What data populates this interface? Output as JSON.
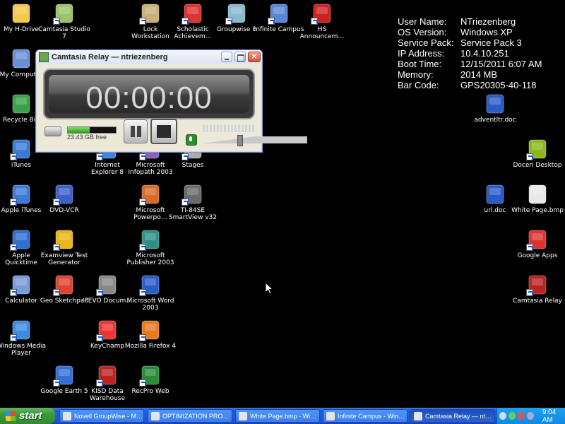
{
  "desktop": {
    "icons": [
      {
        "id": "my-h-drive",
        "label": "My H-Drive",
        "color": "#f2c94c",
        "shortcut": false
      },
      {
        "id": "camtasia-studio",
        "label": "Camtasia Studio 7",
        "color": "#9cc36e",
        "shortcut": true
      },
      {
        "id": "lock-workstation",
        "label": "Lock Workstation",
        "color": "#c9b07a",
        "shortcut": true
      },
      {
        "id": "scholastic",
        "label": "Scholastic Achievem…",
        "color": "#d33",
        "shortcut": true
      },
      {
        "id": "groupwise",
        "label": "Groupwise 8",
        "color": "#8ab8cf",
        "shortcut": true
      },
      {
        "id": "infinite-campus",
        "label": "Infinite Campus",
        "color": "#5a86d6",
        "shortcut": true
      },
      {
        "id": "hs-announcement",
        "label": "HS Announcem…",
        "color": "#c22",
        "shortcut": true
      },
      {
        "id": "my-computer",
        "label": "My Computer",
        "color": "#6a8fd6",
        "shortcut": false
      },
      {
        "id": "recycle-bin",
        "label": "Recycle Bin",
        "color": "#3aa04a",
        "shortcut": false
      },
      {
        "id": "itunes",
        "label": "iTunes",
        "color": "#3b7bd6",
        "shortcut": true
      },
      {
        "id": "internet-explorer",
        "label": "Internet Explorer 8",
        "color": "#3e87d8",
        "shortcut": true
      },
      {
        "id": "infopath",
        "label": "Microsoft Infopath 2003",
        "color": "#8860b8",
        "shortcut": true
      },
      {
        "id": "stages",
        "label": "Stages",
        "color": "#aaa",
        "shortcut": true
      },
      {
        "id": "apple-itunes",
        "label": "Apple iTunes",
        "color": "#3b7bd6",
        "shortcut": true
      },
      {
        "id": "dvd-vcr",
        "label": "DVD-VCR",
        "color": "#3d5fc6",
        "shortcut": true
      },
      {
        "id": "powerpoint",
        "label": "Microsoft Powerpo…",
        "color": "#d66b2a",
        "shortcut": true
      },
      {
        "id": "ti-84se",
        "label": "TI-84SE SmartView v32",
        "color": "#6b6b6b",
        "shortcut": true
      },
      {
        "id": "apple-quicktime",
        "label": "Apple Quicktime",
        "color": "#2e6fd0",
        "shortcut": true
      },
      {
        "id": "examview",
        "label": "Examview Test Generator",
        "color": "#e8b51a",
        "shortcut": true
      },
      {
        "id": "publisher",
        "label": "Microsoft Publisher 2003",
        "color": "#2f8f86",
        "shortcut": true
      },
      {
        "id": "calculator",
        "label": "Calculator",
        "color": "#7a9cd9",
        "shortcut": true
      },
      {
        "id": "geo-sketchpad",
        "label": "Geo Sketchpad",
        "color": "#d43",
        "shortcut": true
      },
      {
        "id": "ipevo",
        "label": "IPEVO Docum…",
        "color": "#888",
        "shortcut": true
      },
      {
        "id": "word",
        "label": "Microsoft Word 2003",
        "color": "#2a5cc6",
        "shortcut": true
      },
      {
        "id": "windows-media-player",
        "label": "Windows Media Player",
        "color": "#3c8be0",
        "shortcut": true
      },
      {
        "id": "keychamp",
        "label": "KeyChamp",
        "color": "#e33",
        "shortcut": true
      },
      {
        "id": "firefox",
        "label": "Mozilla Firefox 4",
        "color": "#e57a1e",
        "shortcut": true
      },
      {
        "id": "google-earth",
        "label": "Google Earth 5",
        "color": "#3270d6",
        "shortcut": true
      },
      {
        "id": "kisd-warehouse",
        "label": "KISD Data Warehouse",
        "color": "#b22",
        "shortcut": true
      },
      {
        "id": "recpro-web",
        "label": "RecPro Web",
        "color": "#2a8a3a",
        "shortcut": true
      },
      {
        "id": "adventltr",
        "label": "adventltr.doc",
        "color": "#2a5cc6",
        "shortcut": false
      },
      {
        "id": "doceri",
        "label": "Doceri Desktop",
        "color": "#8cb81e",
        "shortcut": true
      },
      {
        "id": "url-doc",
        "label": "url.doc",
        "color": "#2a5cc6",
        "shortcut": false
      },
      {
        "id": "white-page",
        "label": "White Page.bmp",
        "color": "#e8e8e8",
        "shortcut": false
      },
      {
        "id": "google-apps",
        "label": "Google Apps",
        "color": "#d33",
        "shortcut": true
      },
      {
        "id": "camtasia-relay",
        "label": "Camtasia Relay",
        "color": "#b22",
        "shortcut": true
      }
    ]
  },
  "bginfo": {
    "rows": [
      {
        "k": "User Name:",
        "v": "NTriezenberg"
      },
      {
        "k": "OS Version:",
        "v": "Windows XP"
      },
      {
        "k": "Service Pack:",
        "v": "Service Pack 3"
      },
      {
        "k": "IP Address:",
        "v": "10.4.10.251"
      },
      {
        "k": "Boot Time:",
        "v": "12/15/2011 6:07 AM"
      },
      {
        "k": "Memory:",
        "v": "2014 MB"
      },
      {
        "k": "Bar Code:",
        "v": "GPS20305-40-118"
      }
    ]
  },
  "camtasia": {
    "title": "Camtasia Relay — ntriezenberg",
    "timer": "00:00:00",
    "free_space": "23.43 GB free",
    "disk_used_fraction": 0.45,
    "volume_fraction": 0.7
  },
  "taskbar": {
    "start_label": "start",
    "tasks": [
      {
        "label": "Novell GroupWise - M…",
        "active": false
      },
      {
        "label": "OPTIMIZATION PRO…",
        "active": false
      },
      {
        "label": "White Page.bmp - Wi…",
        "active": false
      },
      {
        "label": "Infinite Campus - Win…",
        "active": false
      },
      {
        "label": "Camtasia Relay — nt…",
        "active": true
      }
    ],
    "clock": "9:04 AM"
  }
}
